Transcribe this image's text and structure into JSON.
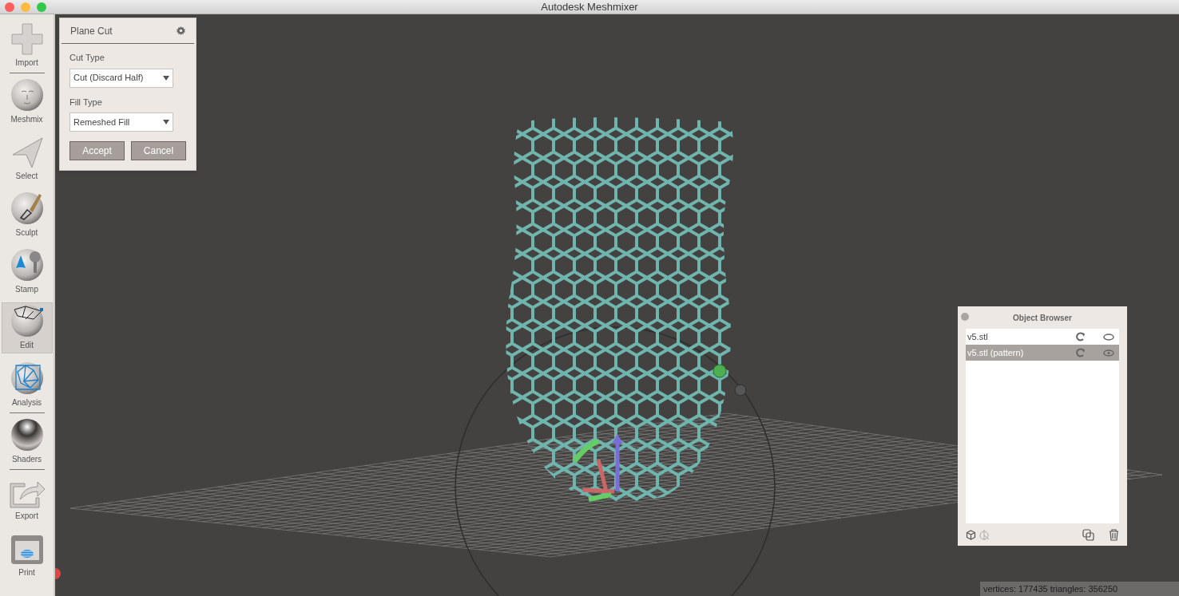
{
  "window": {
    "title": "Autodesk Meshmixer"
  },
  "tools": [
    {
      "label": "Import",
      "kind": "plus",
      "selected": false,
      "divider_after": true
    },
    {
      "label": "Meshmix",
      "kind": "face",
      "selected": false,
      "divider_after": false
    },
    {
      "label": "Select",
      "kind": "cursor",
      "selected": false,
      "divider_after": false
    },
    {
      "label": "Sculpt",
      "kind": "brush",
      "selected": false,
      "divider_after": false
    },
    {
      "label": "Stamp",
      "kind": "stamp",
      "selected": false,
      "divider_after": false
    },
    {
      "label": "Edit",
      "kind": "edit",
      "selected": true,
      "divider_after": false
    },
    {
      "label": "Analysis",
      "kind": "analysis",
      "selected": false,
      "divider_after": true
    },
    {
      "label": "Shaders",
      "kind": "shaders",
      "selected": false,
      "divider_after": true
    },
    {
      "label": "Export",
      "kind": "export",
      "selected": false,
      "divider_after": false
    },
    {
      "label": "Print",
      "kind": "print",
      "selected": false,
      "divider_after": false
    }
  ],
  "plane_cut": {
    "title": "Plane Cut",
    "fields": [
      {
        "label": "Cut Type",
        "value": "Cut (Discard Half)"
      },
      {
        "label": "Fill Type",
        "value": "Remeshed Fill"
      }
    ],
    "buttons": [
      "Accept",
      "Cancel"
    ]
  },
  "object_browser": {
    "title": "Object Browser",
    "objects": [
      {
        "name": "v5.stl",
        "selected": false
      },
      {
        "name": "v5.stl (pattern)",
        "selected": true
      }
    ]
  },
  "status_bar": "vertices: 177435 triangles: 356250"
}
